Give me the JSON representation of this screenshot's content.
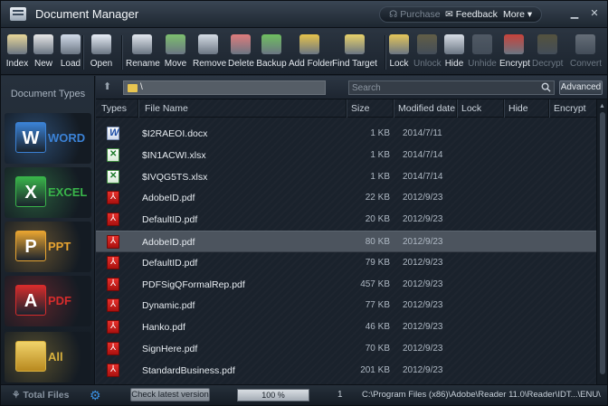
{
  "window": {
    "title": "Document Manager"
  },
  "top_links": {
    "purchase": "Purchase",
    "feedback": "Feedback",
    "more": "More"
  },
  "toolbar": [
    {
      "label": "Index",
      "icon": "index-icon"
    },
    {
      "label": "New",
      "icon": "new-icon"
    },
    {
      "label": "Load",
      "icon": "load-icon"
    },
    {
      "label": "Open",
      "icon": "open-icon"
    },
    {
      "label": "Rename",
      "icon": "rename-icon"
    },
    {
      "label": "Move",
      "icon": "move-icon"
    },
    {
      "label": "Remove",
      "icon": "remove-icon"
    },
    {
      "label": "Delete",
      "icon": "delete-icon"
    },
    {
      "label": "Backup",
      "icon": "backup-icon"
    },
    {
      "label": "Add Folder",
      "icon": "add-folder-icon"
    },
    {
      "label": "Find Target",
      "icon": "find-target-icon"
    },
    {
      "label": "Lock",
      "icon": "lock-icon"
    },
    {
      "label": "Unlock",
      "icon": "unlock-icon",
      "disabled": true
    },
    {
      "label": "Hide",
      "icon": "hide-icon"
    },
    {
      "label": "Unhide",
      "icon": "unhide-icon",
      "disabled": true
    },
    {
      "label": "Encrypt",
      "icon": "encrypt-icon"
    },
    {
      "label": "Decrypt",
      "icon": "decrypt-icon",
      "disabled": true
    },
    {
      "label": "Convert",
      "icon": "convert-icon",
      "disabled": true
    }
  ],
  "sidebar": {
    "title": "Document Types",
    "types": [
      {
        "label": "WORD",
        "badge": "W",
        "color": "#3b82d6"
      },
      {
        "label": "EXCEL",
        "badge": "X",
        "color": "#39b54a"
      },
      {
        "label": "PPT",
        "badge": "P",
        "color": "#e8a431"
      },
      {
        "label": "PDF",
        "badge": "A",
        "color": "#d72c2c"
      },
      {
        "label": "All",
        "badge": "",
        "color": "#d9b13e"
      }
    ]
  },
  "pathbar": {
    "path": "\\",
    "search_placeholder": "Search",
    "advanced": "Advanced"
  },
  "table": {
    "columns": [
      "Types",
      "File Name",
      "Size",
      "Modified date",
      "Lock",
      "Hide",
      "Encrypt"
    ],
    "rows": [
      {
        "type": "word",
        "name": "$I2RAEOI.docx",
        "size": "1 KB",
        "date": "2014/7/11"
      },
      {
        "type": "excel",
        "name": "$IN1ACWI.xlsx",
        "size": "1 KB",
        "date": "2014/7/14"
      },
      {
        "type": "excel",
        "name": "$IVQG5TS.xlsx",
        "size": "1 KB",
        "date": "2014/7/14"
      },
      {
        "type": "pdf",
        "name": "AdobeID.pdf",
        "size": "22 KB",
        "date": "2012/9/23"
      },
      {
        "type": "pdf",
        "name": "DefaultID.pdf",
        "size": "20 KB",
        "date": "2012/9/23"
      },
      {
        "type": "pdf",
        "name": "AdobeID.pdf",
        "size": "80 KB",
        "date": "2012/9/23",
        "selected": true
      },
      {
        "type": "pdf",
        "name": "DefaultID.pdf",
        "size": "79 KB",
        "date": "2012/9/23"
      },
      {
        "type": "pdf",
        "name": "PDFSigQFormalRep.pdf",
        "size": "457 KB",
        "date": "2012/9/23"
      },
      {
        "type": "pdf",
        "name": "Dynamic.pdf",
        "size": "77 KB",
        "date": "2012/9/23"
      },
      {
        "type": "pdf",
        "name": "Hanko.pdf",
        "size": "46 KB",
        "date": "2012/9/23"
      },
      {
        "type": "pdf",
        "name": "SignHere.pdf",
        "size": "70 KB",
        "date": "2012/9/23"
      },
      {
        "type": "pdf",
        "name": "StandardBusiness.pdf",
        "size": "201 KB",
        "date": "2012/9/23"
      }
    ]
  },
  "status": {
    "total_files": "Total Files",
    "check_version": "Check latest version",
    "progress": "100 %",
    "progress_value": 1.0,
    "count": "1",
    "path": "C:\\Program Files (x86)\\Adobe\\Reader 11.0\\Reader\\IDT...\\ENU\\"
  }
}
